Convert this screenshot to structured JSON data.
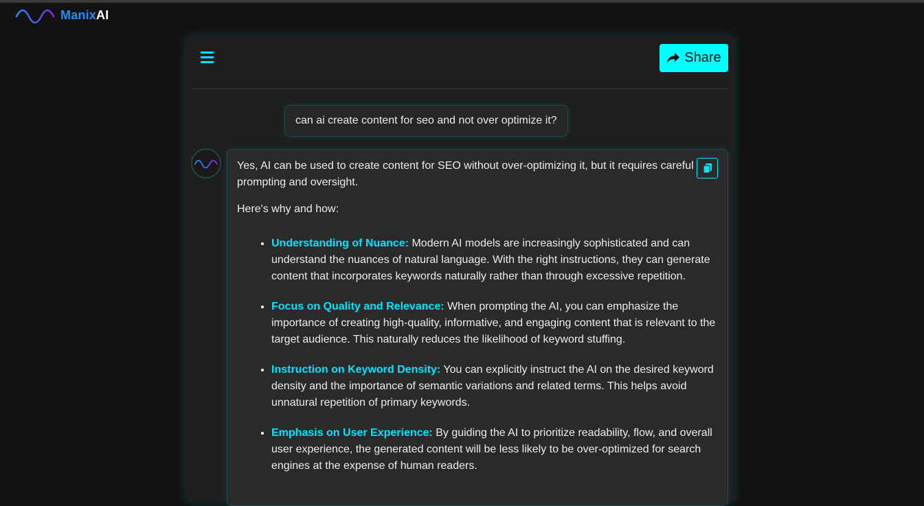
{
  "app": {
    "brand_part1": "Manix",
    "brand_part2": "AI",
    "logo_icon": "wave-icon"
  },
  "toolbar": {
    "menu_icon": "hamburger-menu-icon",
    "share_label": "Share",
    "share_icon": "share-arrow-icon"
  },
  "colors": {
    "accent": "#00e5ff",
    "brand_blue": "#1e90ff",
    "background": "#121212",
    "panel": "#1f1f1f",
    "bubble": "#2a2a2a"
  },
  "chat": {
    "user_message": "can ai create content for seo and not over optimize it?",
    "ai_avatar_icon": "wave-icon",
    "copy_icon": "copy-icon",
    "ai_intro": "Yes, AI can be used to create content for SEO without over-optimizing it, but it requires careful prompting and oversight.",
    "ai_why": "Here's why and how:",
    "points": [
      {
        "title": "Understanding of Nuance:",
        "text": " Modern AI models are increasingly sophisticated and can understand the nuances of natural language. With the right instructions, they can generate content that incorporates keywords naturally rather than through excessive repetition."
      },
      {
        "title": "Focus on Quality and Relevance:",
        "text": " When prompting the AI, you can emphasize the importance of creating high-quality, informative, and engaging content that is relevant to the target audience. This naturally reduces the likelihood of keyword stuffing."
      },
      {
        "title": "Instruction on Keyword Density:",
        "text": " You can explicitly instruct the AI on the desired keyword density and the importance of semantic variations and related terms. This helps avoid unnatural repetition of primary keywords."
      },
      {
        "title": "Emphasis on User Experience:",
        "text": " By guiding the AI to prioritize readability, flow, and overall user experience, the generated content will be less likely to be over-optimized for search engines at the expense of human readers."
      }
    ]
  }
}
